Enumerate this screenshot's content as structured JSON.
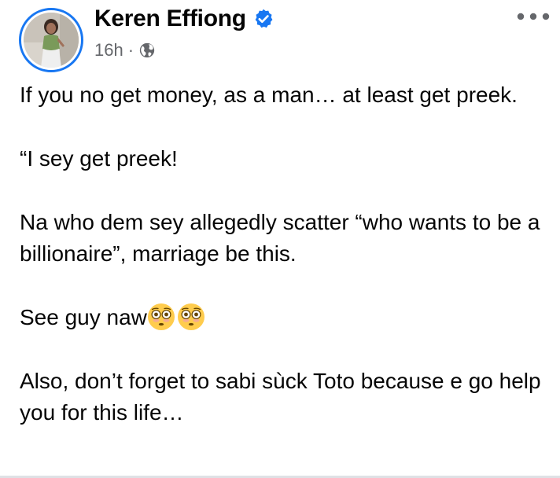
{
  "author": {
    "name": "Keren Effiong",
    "verified_icon": "verified-badge-icon",
    "avatar_icon": "profile-photo"
  },
  "meta": {
    "timestamp": "16h",
    "separator": "·",
    "audience_icon": "globe-icon"
  },
  "actions": {
    "more_icon": "more-options-icon"
  },
  "post": {
    "paragraphs": [
      "If you no get money, as a man… at least get preek.",
      "“I sey get preek!",
      "Na who dem sey allegedly scatter “who wants to be a billionaire”, marriage be this.",
      "See guy naw",
      "Also, don’t forget to sabi sùck Toto because e go help you for this life…"
    ],
    "emojis": [
      "flushed-face-emoji",
      "flushed-face-emoji"
    ]
  },
  "colors": {
    "accent": "#1877f2",
    "text": "#050505",
    "secondary_text": "#65676b",
    "emoji_face": "#ffcc4d"
  }
}
